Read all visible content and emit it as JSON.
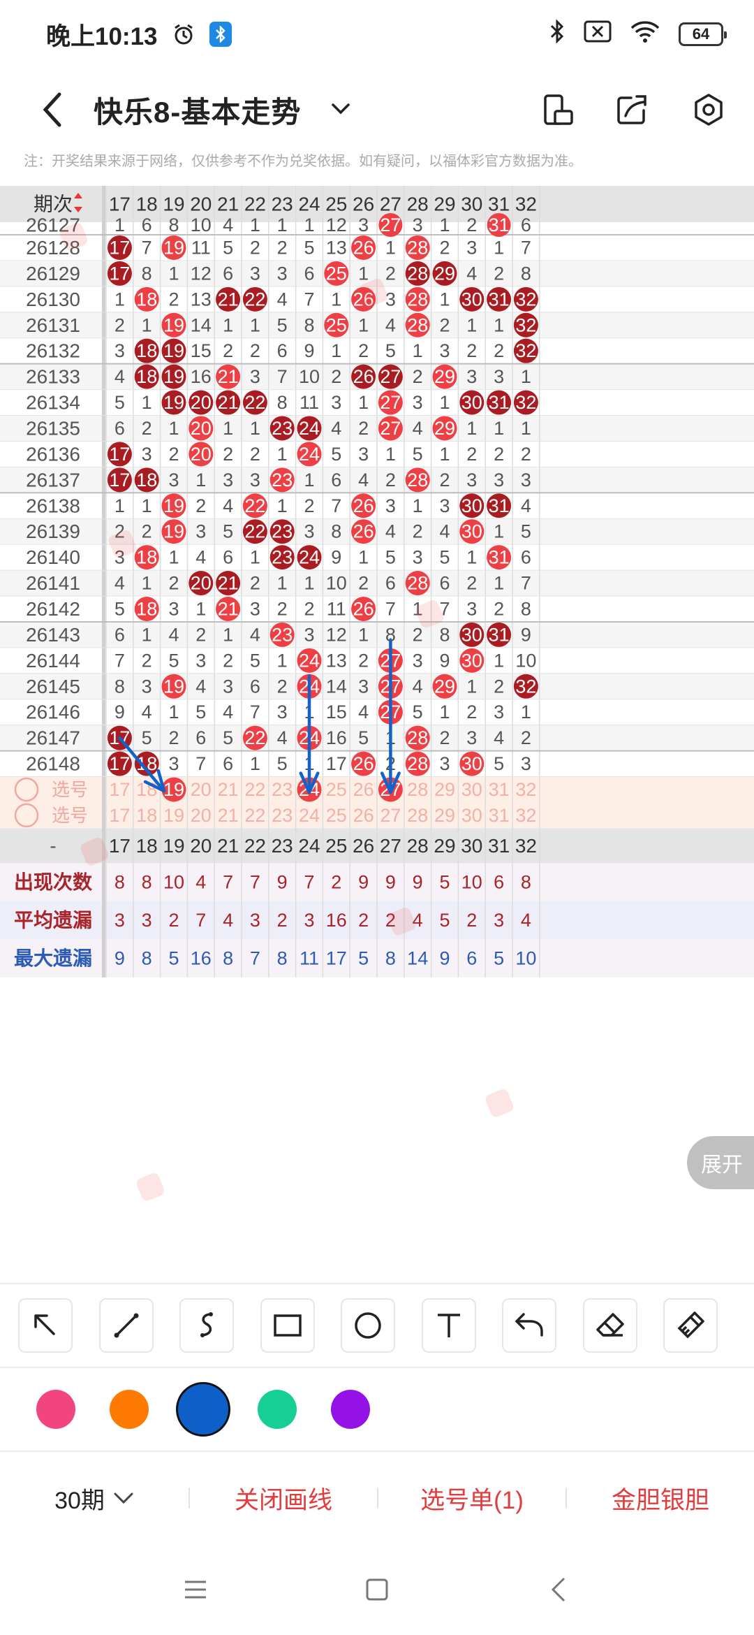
{
  "status": {
    "time": "晚上10:13",
    "battery": "64"
  },
  "header": {
    "title": "快乐8-基本走势"
  },
  "notice": "注：开奖结果来源于网络，仅供参考不作为兑奖依据。如有疑问，以福体彩官方数据为准。",
  "table": {
    "period_header": "期次",
    "columns": [
      "17",
      "18",
      "19",
      "20",
      "21",
      "22",
      "23",
      "24",
      "25",
      "26",
      "27",
      "28",
      "29",
      "30",
      "31",
      "32"
    ],
    "partial_row": {
      "period": "26127",
      "cells": [
        "1",
        "6",
        "8",
        "10",
        "4",
        "1",
        "1",
        "1",
        "12",
        "3",
        "27",
        "3",
        "1",
        "2",
        "31",
        "6"
      ]
    },
    "rows": [
      {
        "period": "26128",
        "cells": [
          "17",
          "7",
          "19",
          "11",
          "5",
          "2",
          "2",
          "5",
          "13",
          "26",
          "1",
          "28",
          "2",
          "3",
          "1",
          "7"
        ]
      },
      {
        "period": "26129",
        "cells": [
          "17",
          "8",
          "1",
          "12",
          "6",
          "3",
          "3",
          "6",
          "25",
          "1",
          "2",
          "28",
          "29",
          "4",
          "2",
          "8"
        ]
      },
      {
        "period": "26130",
        "cells": [
          "1",
          "18",
          "2",
          "13",
          "21",
          "22",
          "4",
          "7",
          "1",
          "26",
          "3",
          "28",
          "1",
          "30",
          "31",
          "32"
        ]
      },
      {
        "period": "26131",
        "cells": [
          "2",
          "1",
          "19",
          "14",
          "1",
          "1",
          "5",
          "8",
          "25",
          "1",
          "4",
          "28",
          "2",
          "1",
          "1",
          "32"
        ]
      },
      {
        "period": "26132",
        "cells": [
          "3",
          "18",
          "19",
          "15",
          "2",
          "2",
          "6",
          "9",
          "1",
          "2",
          "5",
          "1",
          "3",
          "2",
          "2",
          "32"
        ]
      },
      {
        "period": "26133",
        "cells": [
          "4",
          "18",
          "19",
          "16",
          "21",
          "3",
          "7",
          "10",
          "2",
          "26",
          "27",
          "2",
          "29",
          "3",
          "3",
          "1"
        ]
      },
      {
        "period": "26134",
        "cells": [
          "5",
          "1",
          "19",
          "20",
          "21",
          "22",
          "8",
          "11",
          "3",
          "1",
          "27",
          "3",
          "1",
          "30",
          "31",
          "32"
        ]
      },
      {
        "period": "26135",
        "cells": [
          "6",
          "2",
          "1",
          "20",
          "1",
          "1",
          "23",
          "24",
          "4",
          "2",
          "27",
          "4",
          "29",
          "1",
          "1",
          "1"
        ]
      },
      {
        "period": "26136",
        "cells": [
          "17",
          "3",
          "2",
          "20",
          "2",
          "2",
          "1",
          "24",
          "5",
          "3",
          "1",
          "5",
          "1",
          "2",
          "2",
          "2"
        ]
      },
      {
        "period": "26137",
        "cells": [
          "17",
          "18",
          "3",
          "1",
          "3",
          "3",
          "23",
          "1",
          "6",
          "4",
          "2",
          "28",
          "2",
          "3",
          "3",
          "3"
        ]
      },
      {
        "period": "26138",
        "cells": [
          "1",
          "1",
          "19",
          "2",
          "4",
          "22",
          "1",
          "2",
          "7",
          "26",
          "3",
          "1",
          "3",
          "30",
          "31",
          "4"
        ]
      },
      {
        "period": "26139",
        "cells": [
          "2",
          "2",
          "19",
          "3",
          "5",
          "22",
          "23",
          "3",
          "8",
          "26",
          "4",
          "2",
          "4",
          "30",
          "1",
          "5"
        ]
      },
      {
        "period": "26140",
        "cells": [
          "3",
          "18",
          "1",
          "4",
          "6",
          "1",
          "23",
          "24",
          "9",
          "1",
          "5",
          "3",
          "5",
          "1",
          "31",
          "6"
        ]
      },
      {
        "period": "26141",
        "cells": [
          "4",
          "1",
          "2",
          "20",
          "21",
          "2",
          "1",
          "1",
          "10",
          "2",
          "6",
          "28",
          "6",
          "2",
          "1",
          "7"
        ]
      },
      {
        "period": "26142",
        "cells": [
          "5",
          "18",
          "3",
          "1",
          "21",
          "3",
          "2",
          "2",
          "11",
          "26",
          "7",
          "1",
          "7",
          "3",
          "2",
          "8"
        ]
      },
      {
        "period": "26143",
        "cells": [
          "6",
          "1",
          "4",
          "2",
          "1",
          "4",
          "23",
          "3",
          "12",
          "1",
          "8",
          "2",
          "8",
          "30",
          "31",
          "9"
        ]
      },
      {
        "period": "26144",
        "cells": [
          "7",
          "2",
          "5",
          "3",
          "2",
          "5",
          "1",
          "24",
          "13",
          "2",
          "27",
          "3",
          "9",
          "30",
          "1",
          "10"
        ]
      },
      {
        "period": "26145",
        "cells": [
          "8",
          "3",
          "19",
          "4",
          "3",
          "6",
          "2",
          "24",
          "14",
          "3",
          "27",
          "4",
          "29",
          "1",
          "2",
          "32"
        ]
      },
      {
        "period": "26146",
        "cells": [
          "9",
          "4",
          "1",
          "5",
          "4",
          "7",
          "3",
          "1",
          "15",
          "4",
          "27",
          "5",
          "1",
          "2",
          "3",
          "1"
        ]
      },
      {
        "period": "26147",
        "cells": [
          "17",
          "5",
          "2",
          "6",
          "5",
          "22",
          "4",
          "24",
          "16",
          "5",
          "1",
          "28",
          "2",
          "3",
          "4",
          "2"
        ]
      },
      {
        "period": "26148",
        "cells": [
          "17",
          "18",
          "3",
          "7",
          "6",
          "1",
          "5",
          "1",
          "17",
          "26",
          "2",
          "28",
          "3",
          "30",
          "5",
          "3"
        ]
      }
    ],
    "pick_rows": [
      {
        "label": "选号",
        "cells": [
          "17",
          "18",
          "19",
          "20",
          "21",
          "22",
          "23",
          "24",
          "25",
          "26",
          "27",
          "28",
          "29",
          "30",
          "31",
          "32"
        ]
      },
      {
        "label": "选号",
        "cells": [
          "17",
          "18",
          "19",
          "20",
          "21",
          "22",
          "23",
          "24",
          "25",
          "26",
          "27",
          "28",
          "29",
          "30",
          "31",
          "32"
        ]
      }
    ],
    "footer_header": {
      "label": "-",
      "cells": [
        "17",
        "18",
        "19",
        "20",
        "21",
        "22",
        "23",
        "24",
        "25",
        "26",
        "27",
        "28",
        "29",
        "30",
        "31",
        "32"
      ]
    },
    "stats": [
      {
        "label": "出现次数",
        "cells": [
          "8",
          "8",
          "10",
          "4",
          "7",
          "7",
          "9",
          "7",
          "2",
          "9",
          "9",
          "9",
          "5",
          "10",
          "6",
          "8"
        ]
      },
      {
        "label": "平均遗漏",
        "cells": [
          "3",
          "3",
          "2",
          "7",
          "4",
          "3",
          "2",
          "3",
          "16",
          "2",
          "2",
          "4",
          "5",
          "2",
          "3",
          "4"
        ]
      },
      {
        "label": "最大遗漏",
        "cells": [
          "9",
          "8",
          "5",
          "16",
          "8",
          "7",
          "8",
          "11",
          "17",
          "5",
          "8",
          "14",
          "9",
          "6",
          "5",
          "10"
        ]
      }
    ],
    "expand_label": "展开"
  },
  "highlight_colors": {
    "hit": "#ee3f45",
    "consecutive": "#a81c22",
    "pick": "#ee3f45",
    "drawn_line": "#1262c9"
  },
  "tools": [
    "arrow-tool",
    "line-tool",
    "curve-tool",
    "rectangle-tool",
    "circle-tool",
    "text-tool",
    "undo-tool",
    "eraser-tool",
    "clear-tool"
  ],
  "palette": [
    {
      "color": "#f2457f",
      "selected": false
    },
    {
      "color": "#ff7a00",
      "selected": false
    },
    {
      "color": "#0f5fc8",
      "selected": true
    },
    {
      "color": "#16cf95",
      "selected": false
    },
    {
      "color": "#9412e6",
      "selected": false
    }
  ],
  "actions": {
    "period": "30期",
    "close_lines": "关闭画线",
    "pick_list": "选号单(1)",
    "gold_silver": "金胆银胆"
  }
}
